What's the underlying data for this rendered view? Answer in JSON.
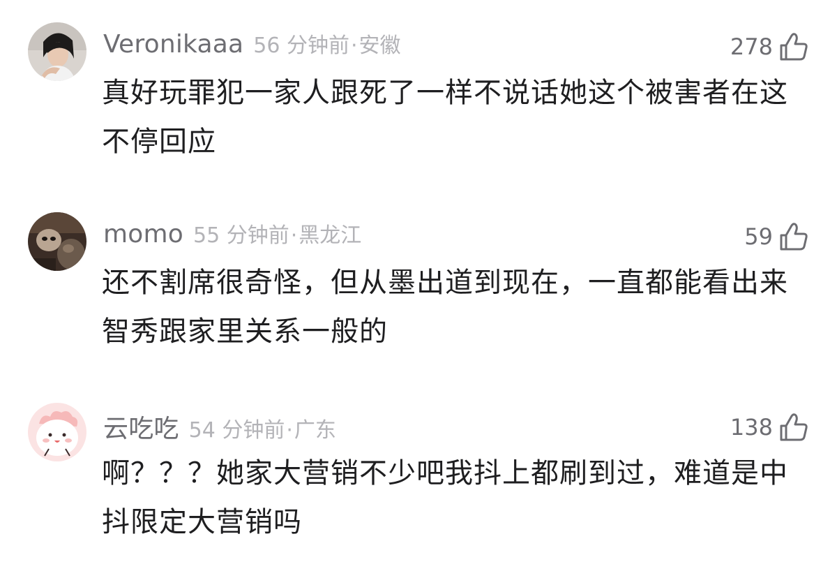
{
  "comments": [
    {
      "username": "Veronikaaa",
      "time": "56 分钟前",
      "separator": "·",
      "location": "安徽",
      "likes": "278",
      "avatar_icon": "person-photo-avatar",
      "text": "真好玩罪犯一家人跟死了一样不说话她这个被害者在这不停回应"
    },
    {
      "username": "momo",
      "time": "55 分钟前",
      "separator": "·",
      "location": "黑龙江",
      "likes": "59",
      "avatar_icon": "cat-photo-avatar",
      "text": "还不割席很奇怪，但从墨出道到现在，一直都能看出来智秀跟家里关系一般的"
    },
    {
      "username": "云吃吃",
      "time": "54 分钟前",
      "separator": "·",
      "location": "广东",
      "likes": "138",
      "avatar_icon": "cartoon-face-avatar",
      "text": "啊？？？她家大营销不少吧我抖上都刷到过，难道是中抖限定大营销吗"
    }
  ],
  "colors": {
    "username": "#6d6d72",
    "meta": "#b3b3b7",
    "text": "#1e1e20",
    "icon": "#6d6d72"
  }
}
